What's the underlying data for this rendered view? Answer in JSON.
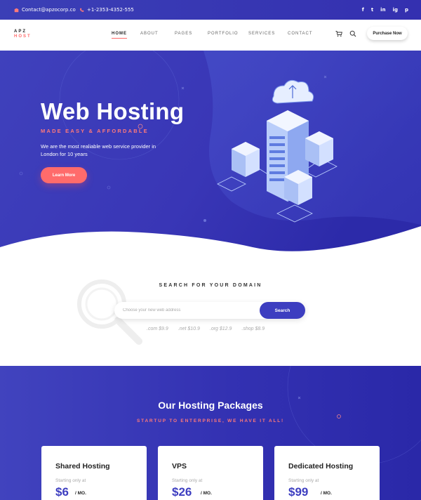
{
  "topbar": {
    "email": "Contact@apzocorp.co",
    "phone": "+1-2353-4352-555",
    "socials": [
      "f",
      "t",
      "in",
      "ig",
      "p"
    ]
  },
  "nav": {
    "logo_line1": "APZ",
    "logo_line2": "HOST",
    "menu": [
      "HOME",
      "ABOUT",
      "PAGES",
      "PORTFOLIO",
      "SERVICES",
      "CONTACT"
    ],
    "active": "HOME",
    "purchase_label": "Purchase Now"
  },
  "hero": {
    "title": "Web Hosting",
    "subtitle": "MADE EASY & AFFORDABLE",
    "description": "We are the most realiable web service provider in London for 10 years",
    "cta_label": "Learn More"
  },
  "domain": {
    "title": "SEARCH FOR YOUR DOMAIN",
    "placeholder": "Choose your new web address",
    "button_label": "Search",
    "tlds": [
      ".com  $9.9",
      ".net  $10.9",
      ".org  $12.9",
      ".shop  $8.9"
    ]
  },
  "packages": {
    "title": "Our Hosting Packages",
    "tagline": "STARTUP TO ENTERPRISE, WE HAVE IT ALL!",
    "cards": [
      {
        "name": "Shared Hosting",
        "starting": "Starting only at",
        "price": "$6",
        "per": "/ MO."
      },
      {
        "name": "VPS",
        "starting": "Starting only at",
        "price": "$26",
        "per": "/ MO."
      },
      {
        "name": "Dedicated Hosting",
        "starting": "Starting only at",
        "price": "$99",
        "per": "/ MO."
      }
    ]
  },
  "colors": {
    "primary": "#3d3ec0",
    "accent": "#ff6b6b",
    "dark": "#222222"
  }
}
